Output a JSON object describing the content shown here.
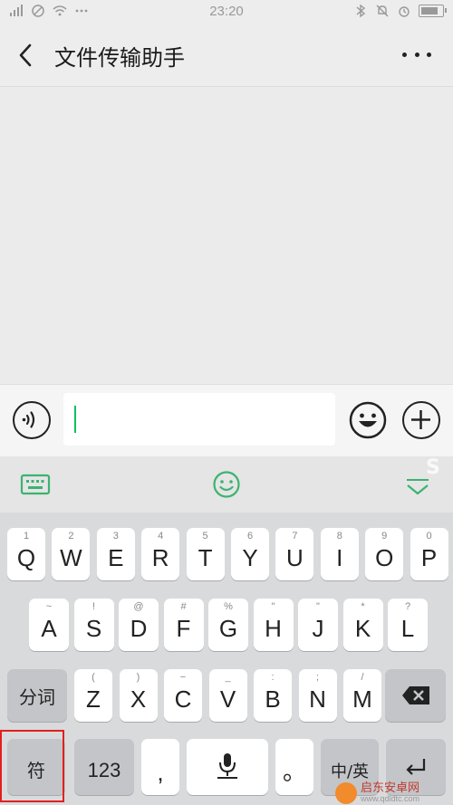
{
  "status_bar": {
    "time": "23:20",
    "colors": {
      "icons": "#999999"
    }
  },
  "header": {
    "title": "文件传输助手"
  },
  "input": {
    "value": ""
  },
  "keyboard": {
    "row1": [
      {
        "sub": "1",
        "label": "Q"
      },
      {
        "sub": "2",
        "label": "W"
      },
      {
        "sub": "3",
        "label": "E"
      },
      {
        "sub": "4",
        "label": "R"
      },
      {
        "sub": "5",
        "label": "T"
      },
      {
        "sub": "6",
        "label": "Y"
      },
      {
        "sub": "7",
        "label": "U"
      },
      {
        "sub": "8",
        "label": "I"
      },
      {
        "sub": "9",
        "label": "O"
      },
      {
        "sub": "0",
        "label": "P"
      }
    ],
    "row2": [
      {
        "sub": "~",
        "label": "A"
      },
      {
        "sub": "!",
        "label": "S"
      },
      {
        "sub": "@",
        "label": "D"
      },
      {
        "sub": "#",
        "label": "F"
      },
      {
        "sub": "%",
        "label": "G"
      },
      {
        "sub": "\"",
        "label": "H"
      },
      {
        "sub": "\"",
        "label": "J"
      },
      {
        "sub": "*",
        "label": "K"
      },
      {
        "sub": "?",
        "label": "L"
      }
    ],
    "row3": [
      {
        "sub": "(",
        "label": "Z"
      },
      {
        "sub": ")",
        "label": "X"
      },
      {
        "sub": "−",
        "label": "C"
      },
      {
        "sub": "_",
        "label": "V"
      },
      {
        "sub": ":",
        "label": "B"
      },
      {
        "sub": ";",
        "label": "N"
      },
      {
        "sub": "/",
        "label": "M"
      }
    ],
    "segment_label": "分词",
    "symbol_label": "符",
    "num_label": "123",
    "comma_label": ",",
    "period_label": "。",
    "lang_label": "中/英"
  },
  "watermark": {
    "name": "启东安卓网",
    "url": "www.qdldtc.com"
  },
  "colors": {
    "accent": "#07c160",
    "highlight": "#e02020",
    "key_func": "#c3c5c9"
  }
}
